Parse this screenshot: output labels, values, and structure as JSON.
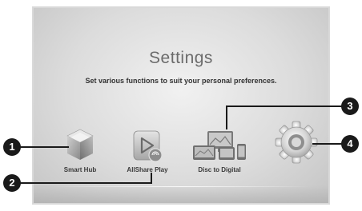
{
  "screen": {
    "title": "Settings",
    "subtitle": "Set various functions to suit your personal preferences."
  },
  "menu": [
    {
      "label": "Smart Hub",
      "icon": "smart-hub-cube-icon"
    },
    {
      "label": "AllShare Play",
      "icon": "allshare-play-icon"
    },
    {
      "label": "Disc to Digital",
      "icon": "disc-to-digital-icon"
    },
    {
      "label": "",
      "icon": "settings-gear-icon"
    }
  ],
  "callouts": [
    "1",
    "2",
    "3",
    "4"
  ]
}
